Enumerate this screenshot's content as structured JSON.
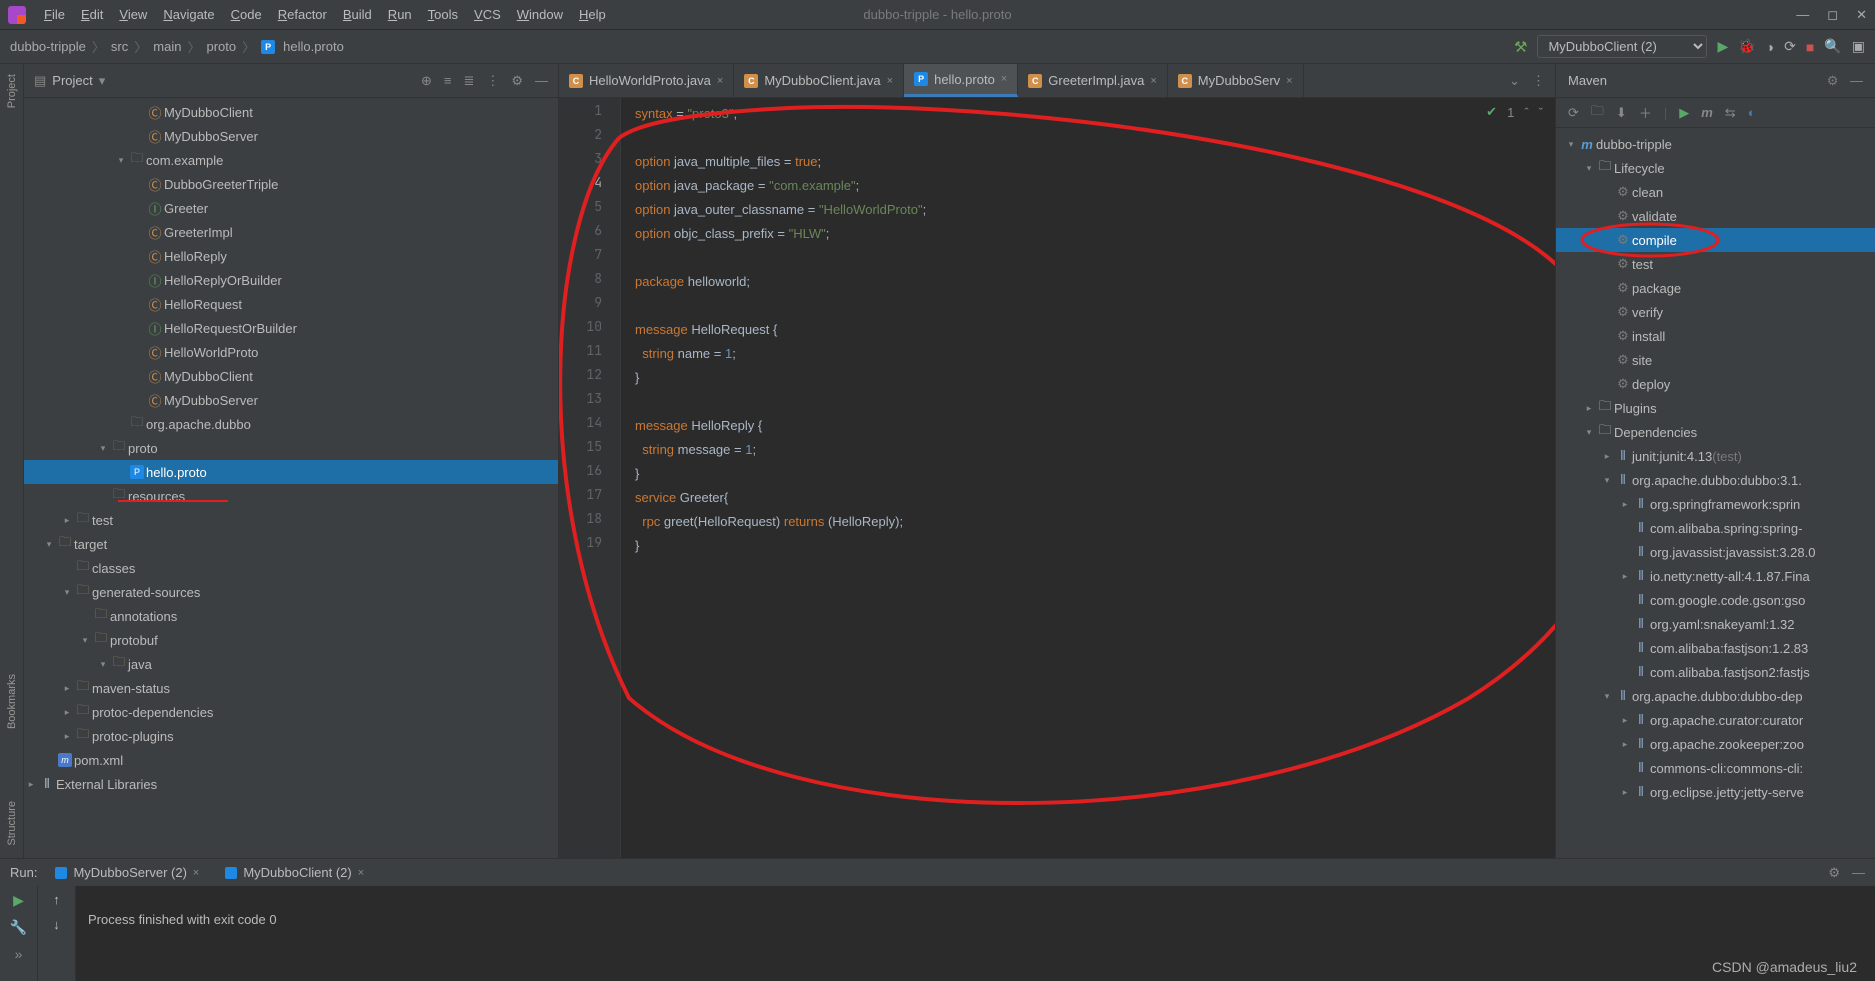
{
  "window": {
    "title": "dubbo-tripple - hello.proto"
  },
  "menu": [
    "File",
    "Edit",
    "View",
    "Navigate",
    "Code",
    "Refactor",
    "Build",
    "Run",
    "Tools",
    "VCS",
    "Window",
    "Help"
  ],
  "breadcrumbs": [
    "dubbo-tripple",
    "src",
    "main",
    "proto",
    "hello.proto"
  ],
  "run_config": "MyDubboClient (2)",
  "project_tool": {
    "title": "Project"
  },
  "project_tree": [
    {
      "d": 6,
      "c": "",
      "ic": "cls",
      "t": "MyDubboClient"
    },
    {
      "d": 6,
      "c": "",
      "ic": "cls",
      "t": "MyDubboServer"
    },
    {
      "d": 5,
      "c": "v",
      "ic": "folderdark",
      "t": "com.example"
    },
    {
      "d": 6,
      "c": "",
      "ic": "cls",
      "t": "DubboGreeterTriple"
    },
    {
      "d": 6,
      "c": "",
      "ic": "iface",
      "t": "Greeter"
    },
    {
      "d": 6,
      "c": "",
      "ic": "cls",
      "t": "GreeterImpl"
    },
    {
      "d": 6,
      "c": "",
      "ic": "cls",
      "t": "HelloReply"
    },
    {
      "d": 6,
      "c": "",
      "ic": "iface",
      "t": "HelloReplyOrBuilder"
    },
    {
      "d": 6,
      "c": "",
      "ic": "cls",
      "t": "HelloRequest"
    },
    {
      "d": 6,
      "c": "",
      "ic": "iface",
      "t": "HelloRequestOrBuilder"
    },
    {
      "d": 6,
      "c": "",
      "ic": "cls",
      "t": "HelloWorldProto"
    },
    {
      "d": 6,
      "c": "",
      "ic": "cls",
      "t": "MyDubboClient"
    },
    {
      "d": 6,
      "c": "",
      "ic": "cls",
      "t": "MyDubboServer"
    },
    {
      "d": 5,
      "c": "",
      "ic": "folderdark",
      "t": "org.apache.dubbo"
    },
    {
      "d": 4,
      "c": "v",
      "ic": "folderdark",
      "t": "proto"
    },
    {
      "d": 5,
      "c": "",
      "ic": "proto",
      "t": "hello.proto",
      "sel": true
    },
    {
      "d": 4,
      "c": "",
      "ic": "folderdark",
      "t": "resources"
    },
    {
      "d": 2,
      "c": ">",
      "ic": "folderdark",
      "t": "test"
    },
    {
      "d": 1,
      "c": "v",
      "ic": "folder",
      "t": "target"
    },
    {
      "d": 2,
      "c": "",
      "ic": "folder",
      "t": "classes"
    },
    {
      "d": 2,
      "c": "v",
      "ic": "folder",
      "t": "generated-sources"
    },
    {
      "d": 3,
      "c": "",
      "ic": "folder",
      "t": "annotations"
    },
    {
      "d": 3,
      "c": "v",
      "ic": "folder",
      "t": "protobuf"
    },
    {
      "d": 4,
      "c": "v",
      "ic": "folder",
      "t": "java"
    },
    {
      "d": 2,
      "c": ">",
      "ic": "folder",
      "t": "maven-status"
    },
    {
      "d": 2,
      "c": ">",
      "ic": "folder",
      "t": "protoc-dependencies"
    },
    {
      "d": 2,
      "c": ">",
      "ic": "folder",
      "t": "protoc-plugins"
    },
    {
      "d": 1,
      "c": "",
      "ic": "m",
      "t": "pom.xml"
    },
    {
      "d": 0,
      "c": ">",
      "ic": "lib",
      "t": "External Libraries"
    }
  ],
  "editor_tabs": [
    {
      "label": "HelloWorldProto.java",
      "ic": "c"
    },
    {
      "label": "MyDubboClient.java",
      "ic": "c"
    },
    {
      "label": "hello.proto",
      "ic": "p",
      "active": true
    },
    {
      "label": "GreeterImpl.java",
      "ic": "c"
    },
    {
      "label": "MyDubboServ",
      "ic": "c"
    }
  ],
  "editor_status": {
    "problems": "1"
  },
  "code_lines": [
    [
      {
        "k": "kw",
        "t": "syntax"
      },
      {
        "k": "",
        "t": " = "
      },
      {
        "k": "str",
        "t": "\"proto3\""
      },
      {
        "k": "",
        "t": ";"
      }
    ],
    [],
    [
      {
        "k": "kw",
        "t": "option"
      },
      {
        "k": "",
        "t": " java_multiple_files = "
      },
      {
        "k": "kw",
        "t": "true"
      },
      {
        "k": "",
        "t": ";"
      }
    ],
    [
      {
        "k": "kw",
        "t": "option"
      },
      {
        "k": "",
        "t": " java_package = "
      },
      {
        "k": "str",
        "t": "\"com.example\""
      },
      {
        "k": "",
        "t": ";"
      }
    ],
    [
      {
        "k": "kw",
        "t": "option"
      },
      {
        "k": "",
        "t": " java_outer_classname = "
      },
      {
        "k": "str",
        "t": "\"HelloWorldProto\""
      },
      {
        "k": "",
        "t": ";"
      }
    ],
    [
      {
        "k": "kw",
        "t": "option"
      },
      {
        "k": "",
        "t": " objc_class_prefix = "
      },
      {
        "k": "str",
        "t": "\"HLW\""
      },
      {
        "k": "",
        "t": ";"
      }
    ],
    [],
    [
      {
        "k": "kw",
        "t": "package"
      },
      {
        "k": "",
        "t": " "
      },
      {
        "k": "underwave",
        "t": "helloworld"
      },
      {
        "k": "",
        "t": ";"
      }
    ],
    [],
    [
      {
        "k": "kw",
        "t": "message"
      },
      {
        "k": "",
        "t": " HelloRequest {"
      }
    ],
    [
      {
        "k": "",
        "t": "  "
      },
      {
        "k": "kw",
        "t": "string"
      },
      {
        "k": "",
        "t": " name = "
      },
      {
        "k": "num",
        "t": "1"
      },
      {
        "k": "",
        "t": ";"
      }
    ],
    [
      {
        "k": "",
        "t": "}"
      }
    ],
    [],
    [
      {
        "k": "kw",
        "t": "message"
      },
      {
        "k": "",
        "t": " HelloReply {"
      }
    ],
    [
      {
        "k": "",
        "t": "  "
      },
      {
        "k": "kw",
        "t": "string"
      },
      {
        "k": "",
        "t": " message = "
      },
      {
        "k": "num",
        "t": "1"
      },
      {
        "k": "",
        "t": ";"
      }
    ],
    [
      {
        "k": "",
        "t": "}"
      }
    ],
    [
      {
        "k": "kw",
        "t": "service"
      },
      {
        "k": "",
        "t": " Greeter{"
      }
    ],
    [
      {
        "k": "",
        "t": "  "
      },
      {
        "k": "kw",
        "t": "rpc"
      },
      {
        "k": "",
        "t": " greet(HelloRequest) "
      },
      {
        "k": "kw",
        "t": "returns"
      },
      {
        "k": "",
        "t": " (HelloReply);"
      }
    ],
    [
      {
        "k": "",
        "t": "}"
      }
    ]
  ],
  "current_line": 4,
  "maven": {
    "title": "Maven",
    "tree": [
      {
        "d": 0,
        "c": "v",
        "ic": "m",
        "t": "dubbo-tripple"
      },
      {
        "d": 1,
        "c": "v",
        "ic": "folderdark",
        "t": "Lifecycle"
      },
      {
        "d": 2,
        "c": "",
        "ic": "gear",
        "t": "clean"
      },
      {
        "d": 2,
        "c": "",
        "ic": "gear",
        "t": "validate"
      },
      {
        "d": 2,
        "c": "",
        "ic": "gear",
        "t": "compile",
        "sel": true
      },
      {
        "d": 2,
        "c": "",
        "ic": "gear",
        "t": "test"
      },
      {
        "d": 2,
        "c": "",
        "ic": "gear",
        "t": "package"
      },
      {
        "d": 2,
        "c": "",
        "ic": "gear",
        "t": "verify"
      },
      {
        "d": 2,
        "c": "",
        "ic": "gear",
        "t": "install"
      },
      {
        "d": 2,
        "c": "",
        "ic": "gear",
        "t": "site"
      },
      {
        "d": 2,
        "c": "",
        "ic": "gear",
        "t": "deploy"
      },
      {
        "d": 1,
        "c": ">",
        "ic": "folderdark",
        "t": "Plugins"
      },
      {
        "d": 1,
        "c": "v",
        "ic": "folderdark",
        "t": "Dependencies"
      },
      {
        "d": 2,
        "c": ">",
        "ic": "mlib",
        "t": "junit:junit:4.13",
        "suffix": " (test)"
      },
      {
        "d": 2,
        "c": "v",
        "ic": "mlib",
        "t": "org.apache.dubbo:dubbo:3.1."
      },
      {
        "d": 3,
        "c": ">",
        "ic": "mlib",
        "t": "org.springframework:sprin"
      },
      {
        "d": 3,
        "c": "",
        "ic": "mlib",
        "t": "com.alibaba.spring:spring-"
      },
      {
        "d": 3,
        "c": "",
        "ic": "mlib",
        "t": "org.javassist:javassist:3.28.0"
      },
      {
        "d": 3,
        "c": ">",
        "ic": "mlib",
        "t": "io.netty:netty-all:4.1.87.Fina"
      },
      {
        "d": 3,
        "c": "",
        "ic": "mlib",
        "t": "com.google.code.gson:gso"
      },
      {
        "d": 3,
        "c": "",
        "ic": "mlib",
        "t": "org.yaml:snakeyaml:1.32"
      },
      {
        "d": 3,
        "c": "",
        "ic": "mlib",
        "t": "com.alibaba:fastjson:1.2.83"
      },
      {
        "d": 3,
        "c": "",
        "ic": "mlib",
        "t": "com.alibaba.fastjson2:fastjs"
      },
      {
        "d": 2,
        "c": "v",
        "ic": "mlib",
        "t": "org.apache.dubbo:dubbo-dep"
      },
      {
        "d": 3,
        "c": ">",
        "ic": "mlib",
        "t": "org.apache.curator:curator"
      },
      {
        "d": 3,
        "c": ">",
        "ic": "mlib",
        "t": "org.apache.zookeeper:zoo"
      },
      {
        "d": 3,
        "c": "",
        "ic": "mlib",
        "t": "commons-cli:commons-cli:"
      },
      {
        "d": 3,
        "c": ">",
        "ic": "mlib",
        "t": "org.eclipse.jetty:jetty-serve"
      }
    ]
  },
  "run_tool": {
    "title": "Run:",
    "tabs": [
      {
        "label": "MyDubboServer (2)"
      },
      {
        "label": "MyDubboClient (2)"
      }
    ],
    "output": "\nProcess finished with exit code 0"
  },
  "watermark": "CSDN @amadeus_liu2",
  "left_tabs": [
    "Project",
    "Bookmarks",
    "Structure"
  ]
}
